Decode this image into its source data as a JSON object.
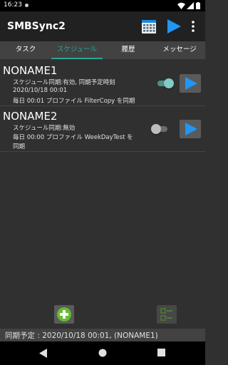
{
  "status_bar": {
    "time": "16:23"
  },
  "app_bar": {
    "title": "SMBSync2",
    "calendar_icon": "calendar-grid-icon",
    "run_icon": "play-icon",
    "overflow_icon": "more-vert-icon"
  },
  "tabs": [
    {
      "label": "タスク",
      "active": false
    },
    {
      "label": "スケジュール",
      "active": true
    },
    {
      "label": "履歴",
      "active": false
    },
    {
      "label": "メッセージ",
      "active": false
    }
  ],
  "schedules": [
    {
      "name": "NONAME1",
      "lines": [
        "スケジュール同期:有効, 同期予定時刻",
        "2020/10/18 00:01",
        "毎日 00:01 プロファイル FilterCopy を同期"
      ],
      "enabled": true
    },
    {
      "name": "NONAME2",
      "lines": [
        "スケジュール同期:無効",
        "毎日 00:00 プロファイル WeekDayTest を",
        "同期"
      ],
      "enabled": false
    }
  ],
  "footer": {
    "next_sync": "同期予定 : 2020/10/18 00:01, (NONAME1)"
  },
  "colors": {
    "accent": "#26a69a",
    "play_blue": "#2196f3",
    "add_green": "#66bb34"
  }
}
